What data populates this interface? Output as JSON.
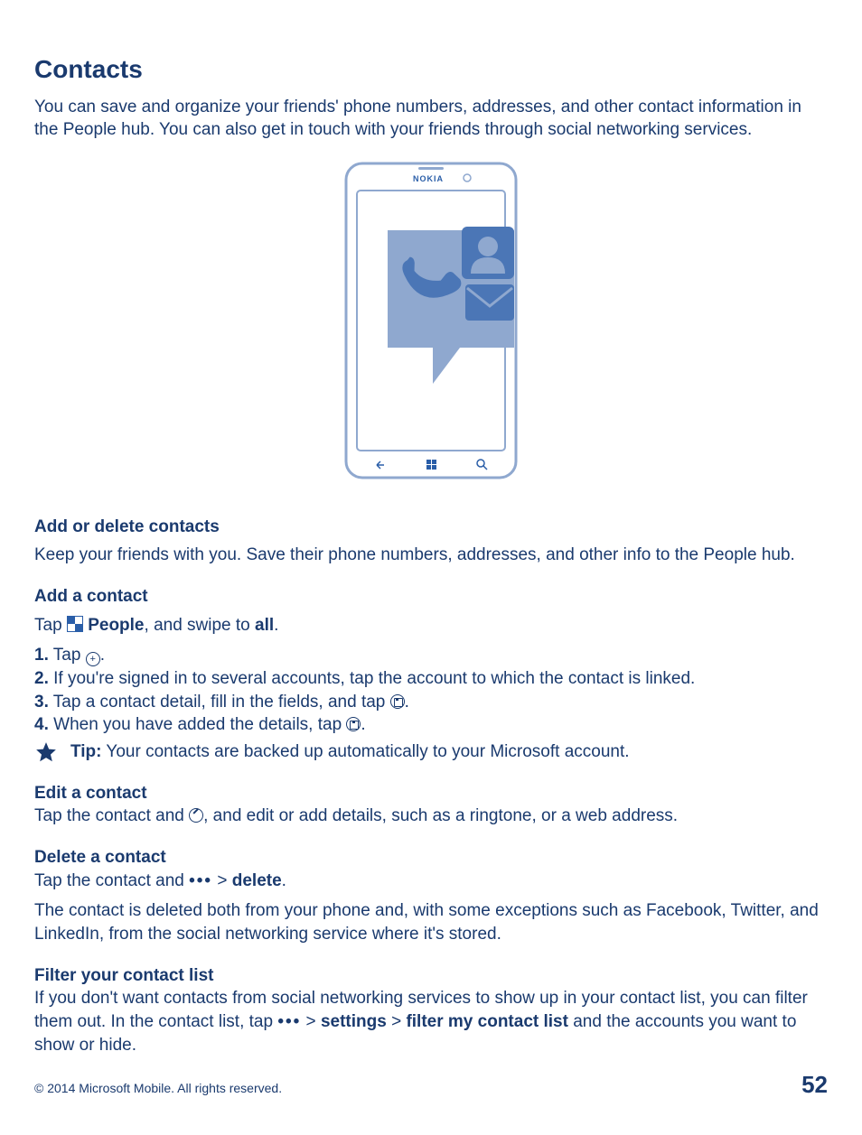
{
  "title": "Contacts",
  "intro": "You can save and organize your friends' phone numbers, addresses, and other contact information in the People hub. You can also get in touch with your friends through social networking services.",
  "phone_brand": "NOKIA",
  "sec_add_delete": {
    "heading": "Add or delete contacts",
    "body": "Keep your friends with you. Save their phone numbers, addresses, and other info to the People hub."
  },
  "sec_add": {
    "heading": "Add a contact",
    "line_pre": "Tap ",
    "people_label": "People",
    "line_post": ", and swipe to ",
    "all": "all",
    "step1_num": "1.",
    "step1_pre": " Tap ",
    "step2_num": "2.",
    "step2": " If you're signed in to several accounts, tap the account to which the contact is linked.",
    "step3_num": "3.",
    "step3_pre": " Tap a contact detail, fill in the fields, and tap ",
    "step4_num": "4.",
    "step4_pre": " When you have added the details, tap ",
    "tip_label": "Tip:",
    "tip_body": " Your contacts are backed up automatically to your Microsoft account."
  },
  "sec_edit": {
    "heading": "Edit a contact",
    "pre": "Tap the contact and ",
    "post": ", and edit or add details, such as a ringtone, or a web address."
  },
  "sec_delete": {
    "heading": "Delete a contact",
    "pre": "Tap the contact and  ",
    "dots": "•••",
    "gt": "  > ",
    "del": "delete",
    "body2": "The contact is deleted both from your phone and, with some exceptions such as Facebook, Twitter, and LinkedIn, from the social networking service where it's stored."
  },
  "sec_filter": {
    "heading": "Filter your contact list",
    "pre": "If you don't want contacts from social networking services to show up in your contact list, you can filter them out. In the contact list, tap  ",
    "dots": "•••",
    "gt1": "  > ",
    "settings": "settings",
    "gt2": " > ",
    "filter": "filter my contact list",
    "post": " and the accounts you want to show or hide."
  },
  "footer": {
    "copyright": "© 2014 Microsoft Mobile. All rights reserved.",
    "page": "52"
  }
}
